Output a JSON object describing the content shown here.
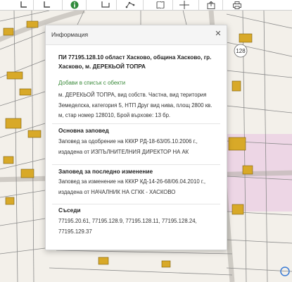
{
  "toolbar": {
    "buttons": [
      {
        "name": "corner-tool-icon"
      },
      {
        "name": "corner-tool-2-icon"
      },
      {
        "name": "info-icon"
      },
      {
        "name": "rectangle-tool-icon"
      },
      {
        "name": "polygon-tool-icon"
      },
      {
        "name": "map-icon"
      },
      {
        "name": "crosshair-icon"
      },
      {
        "name": "export-icon"
      },
      {
        "name": "print-icon"
      }
    ]
  },
  "map": {
    "parcel_numbers": [
      "128"
    ]
  },
  "dialog": {
    "title": "Информация",
    "close_label": "✕",
    "object_title": "ПИ 77195.128.10 област Хасково, община Хасково, гр. Хасково, м. ДЕРЕКЬОЙ ТОПРА",
    "add_to_list": "Добави в списък с обекти",
    "description": "м. ДЕРЕКЬОЙ ТОПРА, вид собств. Частна, вид територия Земеделска, категория 5, НТП Друг вид нива, площ 2800 кв. м, стар номер 128010, Брой върхове: 13 бр.",
    "sections": [
      {
        "title": "Основна заповед",
        "text": "Заповед за одобрение на КККР РД-18-63/05.10.2006 г., издадена от ИЗПЪЛНИТЕЛНИЯ ДИРЕКТОР НА АК"
      },
      {
        "title": "Заповед за последно изменение",
        "text": "Заповед за изменение на КККР КД-14-26-68/06.04.2010 г., издадена от НАЧАЛНИК НА СГКК - ХАСКОВО"
      },
      {
        "title": "Съседи",
        "text": "77195.20.61, 77195.128.9, 77195.128.11, 77195.128.24, 77195.129.37"
      }
    ]
  },
  "colors": {
    "building": "#d8a928",
    "map_bg": "#f3f0ea",
    "parcel_line": "#8a8a8a",
    "link_green": "#3a8a3a",
    "highlight_pink": "#e8cfe0"
  }
}
